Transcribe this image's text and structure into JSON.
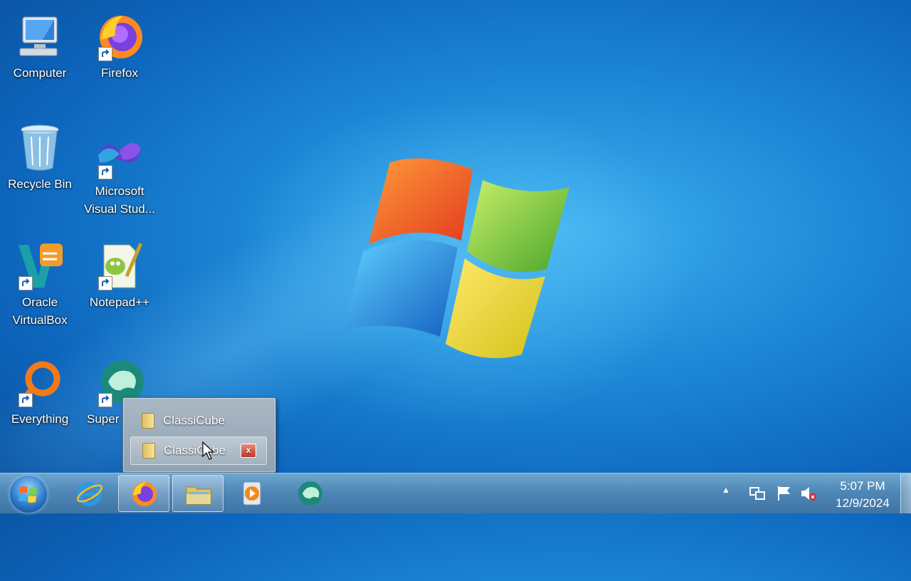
{
  "desktop": {
    "icons": [
      {
        "label_1": "Computer",
        "label_2": ""
      },
      {
        "label_1": "Firefox",
        "label_2": ""
      },
      {
        "label_1": "Recycle Bin",
        "label_2": ""
      },
      {
        "label_1": "Microsoft",
        "label_2": "Visual Stud..."
      },
      {
        "label_1": "Oracle",
        "label_2": "VirtualBox"
      },
      {
        "label_1": "Notepad++",
        "label_2": ""
      },
      {
        "label_1": "Everything",
        "label_2": ""
      },
      {
        "label_1": "Super",
        "label_2": ""
      }
    ]
  },
  "jumplist": {
    "items": [
      {
        "label": "ClassiCube",
        "icon": "folder-icon"
      },
      {
        "label": "ClassiCube",
        "icon": "folder-icon",
        "close_label": "x"
      }
    ]
  },
  "taskbar": {
    "pinned": [
      {
        "name": "internet-explorer",
        "active": false
      },
      {
        "name": "firefox",
        "active": true
      },
      {
        "name": "file-explorer",
        "active": true
      },
      {
        "name": "media-player",
        "active": false
      },
      {
        "name": "supercopier",
        "active": false
      }
    ],
    "tray": {
      "show_hidden": "▲",
      "icons": [
        "network-icon",
        "action-center-flag-icon",
        "volume-muted-icon"
      ]
    },
    "clock": {
      "time": "5:07 PM",
      "date": "12/9/2024"
    }
  },
  "colors": {
    "taskbar": "#4f87b7",
    "desktop_accent": "#1e8ad8"
  }
}
